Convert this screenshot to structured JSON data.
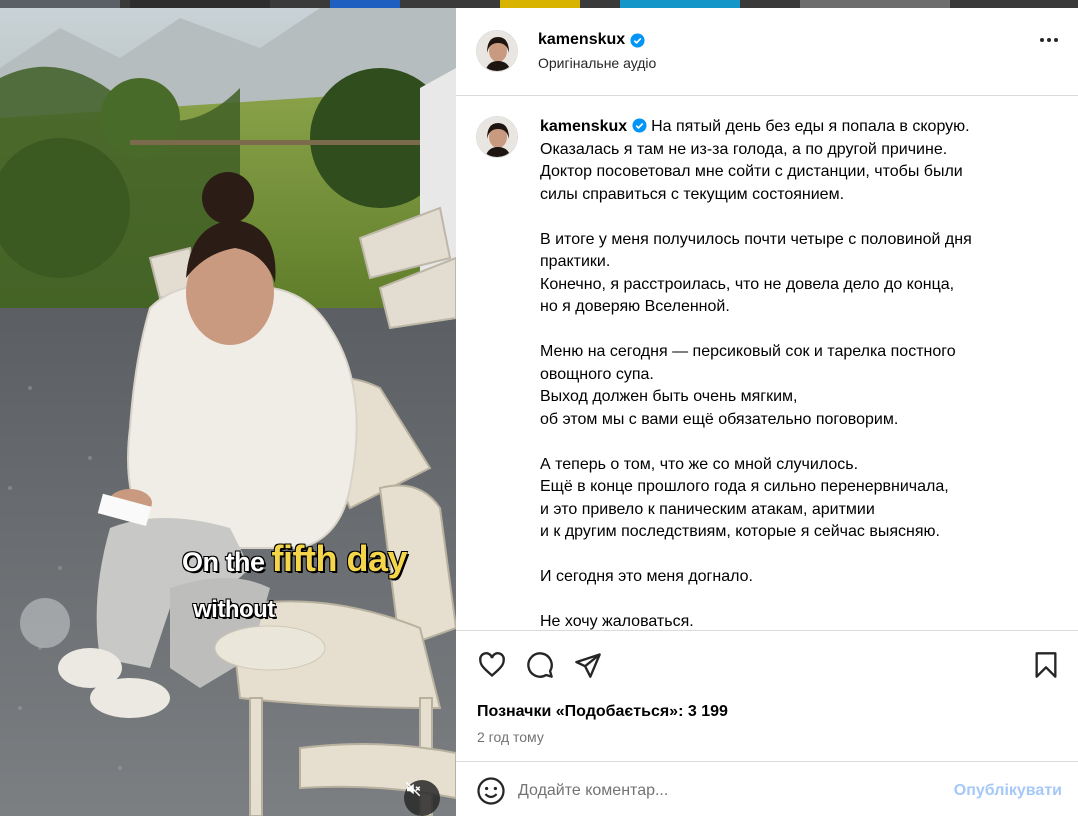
{
  "post": {
    "username": "kamenskux",
    "audio_label": "Оригінальне аудіо",
    "caption_paragraphs": [
      [
        "На пятый день без еды я попала в скорую.",
        "Оказалась я там не из-за голода, а по другой причине.",
        "Доктор посоветовал мне сойти с дистанции, чтобы были",
        "силы справиться с текущим состоянием."
      ],
      [
        "В итоге у меня получилось почти четыре с половиной дня",
        "практики.",
        "Конечно, я расстроилась, что не довела дело до конца,",
        "но я доверяю Вселенной."
      ],
      [
        "Меню на сегодня — персиковый сок и тарелка постного",
        "овощного супа.",
        "Выход должен быть очень мягким,",
        "об этом мы с вами ещё обязательно поговорим."
      ],
      [
        "А теперь о том, что же со мной случилось.",
        "Ещё в конце прошлого года я сильно перенервничала,",
        "и это привело к паническим атакам, аритмии",
        "и к другим последствиям, которые я сейчас выясняю."
      ],
      [
        "И сегодня это меня догнало."
      ],
      [
        "Не хочу жаловаться."
      ]
    ],
    "likes_text": "Позначки «Подобається»: 3 199",
    "time_ago": "2 год тому"
  },
  "video": {
    "caption_line1_a": "On the",
    "caption_line1_b": "fifth day",
    "caption_line2": "without",
    "mute_icon": "speaker-muted-icon"
  },
  "actions": {
    "icons": [
      "heart-icon",
      "comment-icon",
      "share-icon",
      "bookmark-icon"
    ]
  },
  "comment_box": {
    "placeholder": "Додайте коментар...",
    "publish_label": "Опублікувати"
  },
  "colors": {
    "verified": "#0095f6",
    "publish_disabled": "#a5c8f7",
    "caption_highlight": "#f5d64a"
  }
}
